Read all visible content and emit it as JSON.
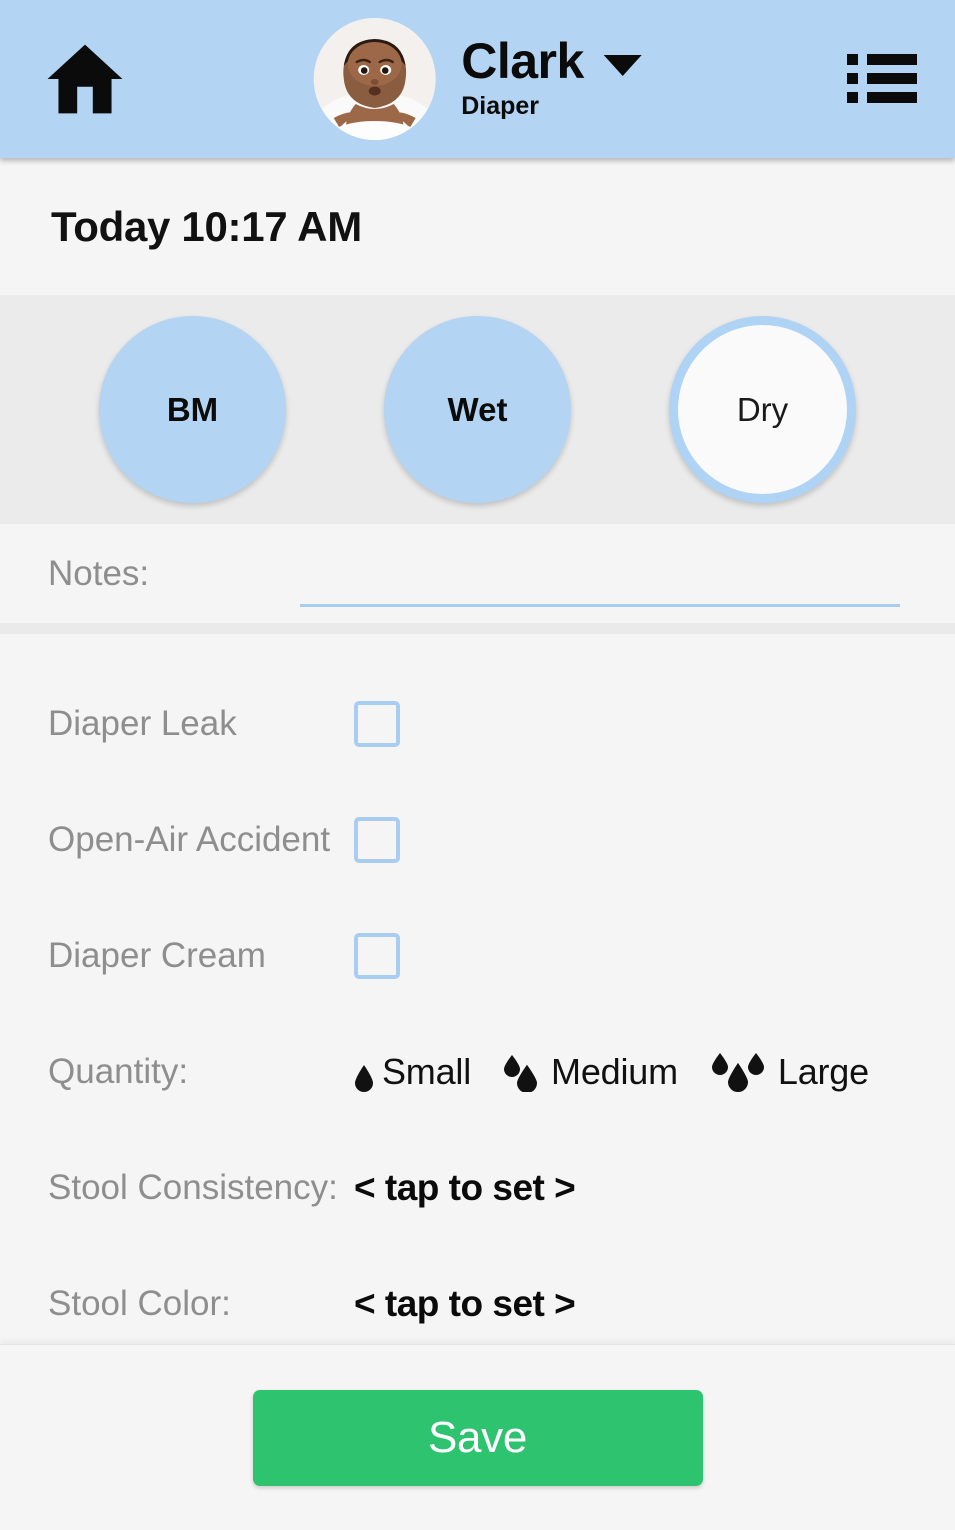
{
  "header": {
    "home_icon": "home-icon",
    "avatar_alt": "baby-avatar",
    "baby_name": "Clark",
    "subtitle": "Diaper",
    "dropdown_icon": "chevron-down-icon",
    "menu_icon": "list-menu-icon",
    "background_color": "#b3d4f2"
  },
  "entry": {
    "timestamp": "Today 10:17 AM"
  },
  "status_options": [
    {
      "label": "BM",
      "selected": true
    },
    {
      "label": "Wet",
      "selected": true
    },
    {
      "label": "Dry",
      "selected": false
    }
  ],
  "notes": {
    "label": "Notes:",
    "value": "",
    "placeholder": ""
  },
  "checkboxes": [
    {
      "label": "Diaper Leak",
      "checked": false
    },
    {
      "label": "Open-Air Accident",
      "checked": false
    },
    {
      "label": "Diaper Cream",
      "checked": false
    }
  ],
  "quantity": {
    "label": "Quantity:",
    "options": [
      {
        "label": "Small",
        "drops": 1,
        "selected": false
      },
      {
        "label": "Medium",
        "drops": 2,
        "selected": false
      },
      {
        "label": "Large",
        "drops": 3,
        "selected": false
      }
    ]
  },
  "stool_consistency": {
    "label": "Stool Consistency:",
    "value": "< tap to set >"
  },
  "stool_color": {
    "label": "Stool Color:",
    "value": "< tap to set >"
  },
  "footer": {
    "save_label": "Save",
    "save_color": "#2ec46f"
  }
}
